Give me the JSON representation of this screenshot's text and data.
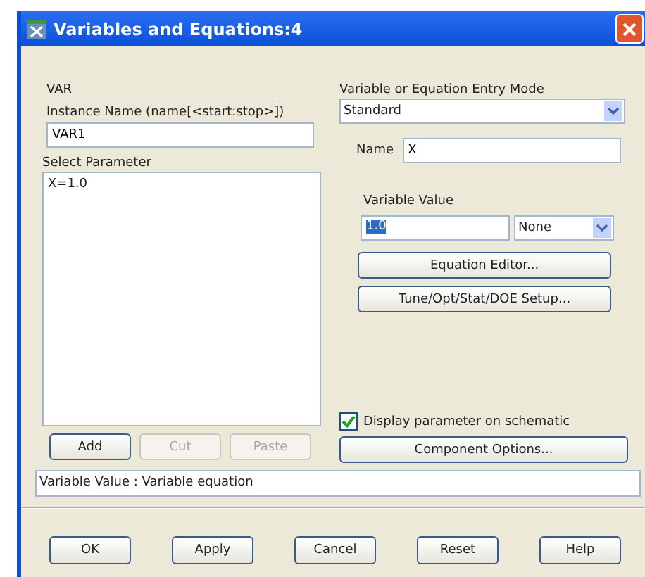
{
  "window": {
    "title": "Variables and Equations:4"
  },
  "component_label": "VAR",
  "instance_name": {
    "label": "Instance Name  (name[<start:stop>])",
    "value": "VAR1"
  },
  "parameters": {
    "label": "Select Parameter",
    "items": [
      "X=1.0"
    ]
  },
  "list_buttons": [
    {
      "label": "Add",
      "disabled": false
    },
    {
      "label": "Cut",
      "disabled": true
    },
    {
      "label": "Paste",
      "disabled": true
    }
  ],
  "entry_mode": {
    "label": "Variable or Equation Entry Mode",
    "value": "Standard"
  },
  "name": {
    "label": "Name",
    "value": "X"
  },
  "variable_value": {
    "label": "Variable Value",
    "value": "1.0",
    "highlighted": true,
    "unit": "None"
  },
  "side_buttons": [
    "Equation Editor...",
    "Tune/Opt/Stat/DOE Setup..."
  ],
  "display_checkbox": {
    "label": "Display parameter on schematic",
    "checked": true
  },
  "component_options": "Component Options...",
  "status": "Variable Value : Variable equation",
  "dialog_buttons": [
    "OK",
    "Apply",
    "Cancel",
    "Reset",
    "Help"
  ]
}
